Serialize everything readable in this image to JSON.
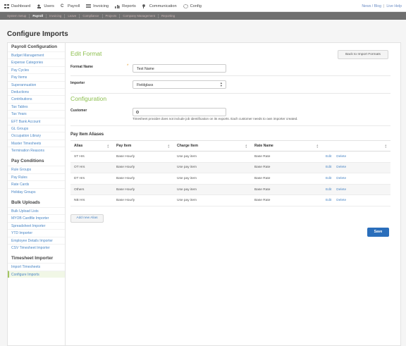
{
  "topnav": [
    {
      "label": "Dashboard",
      "icon": "dashboard-icon"
    },
    {
      "label": "Users",
      "icon": "users-icon"
    },
    {
      "label": "Payroll",
      "icon": "payroll-icon"
    },
    {
      "label": "Invoicing",
      "icon": "invoicing-icon"
    },
    {
      "label": "Reports",
      "icon": "reports-icon"
    },
    {
      "label": "Communication",
      "icon": "communication-icon"
    },
    {
      "label": "Config",
      "icon": "gear-icon"
    }
  ],
  "toplinks": {
    "news": "News / Blog",
    "help": "Live Help"
  },
  "subnav": [
    "System Setup",
    "Payroll",
    "Invoicing",
    "Leave",
    "Compliance",
    "Projects",
    "Company Management",
    "Reporting"
  ],
  "page_title": "Configure Imports",
  "sidebar": {
    "sections": [
      {
        "title": "Payroll Configuration",
        "items": [
          "Budget Management",
          "Expense Categories",
          "Pay Cycles",
          "Pay Items",
          "Superannuation",
          "Deductions",
          "Contributions",
          "Tax Tables",
          "Tax Years",
          "EFT Bank Account",
          "GL Groups",
          "Occupation Library",
          "Master Timesheets",
          "Termination Reasons"
        ]
      },
      {
        "title": "Pay Conditions",
        "items": [
          "Rule Groups",
          "Pay Rules",
          "Rate Cards",
          "Holiday Groups"
        ]
      },
      {
        "title": "Bulk Uploads",
        "items": [
          "Bulk Upload Lists",
          "MYOB Cardfile Importer",
          "Spreadsheet Importer",
          "YTD Importer",
          "Employee Details Importer",
          "CSV Timesheet Importer"
        ]
      },
      {
        "title": "Timesheet Importer",
        "items": [
          "Import Timesheets",
          "Configure Imports"
        ]
      }
    ],
    "active_item": "Configure Imports"
  },
  "edit_format": {
    "heading": "Edit Format",
    "back_button": "Back to Import Formats",
    "format_name_label": "Format Name",
    "required_mark": "*",
    "format_name_value": "Test Name",
    "importer_label": "Importer",
    "importer_value": "Fieldglass"
  },
  "configuration": {
    "heading": "Configuration",
    "customer_label": "Customer",
    "customer_value": "",
    "hint": "Timesheet provider does not include job identification on its exports. Each customer needs to own importer created."
  },
  "aliases": {
    "heading": "Pay Item Aliases",
    "columns": [
      "Alias",
      "Pay Item",
      "Charge Item",
      "Rate Name",
      ""
    ],
    "rows": [
      {
        "alias": "ST Hrs",
        "pay_item": "Base Hourly",
        "charge_item": "Use pay item",
        "rate_name": "Base Rate"
      },
      {
        "alias": "OT Hrs",
        "pay_item": "Base Hourly",
        "charge_item": "Use pay item",
        "rate_name": "Base Rate"
      },
      {
        "alias": "DT Hrs",
        "pay_item": "Base Hourly",
        "charge_item": "Use pay item",
        "rate_name": "Base Rate"
      },
      {
        "alias": "Others",
        "pay_item": "Base Hourly",
        "charge_item": "Use pay item",
        "rate_name": "Base Rate"
      },
      {
        "alias": "NB Hrs",
        "pay_item": "Base Hourly",
        "charge_item": "Use pay item",
        "rate_name": "Base Rate"
      }
    ],
    "edit_label": "Edit",
    "delete_label": "Delete",
    "add_button": "Add new Alias"
  },
  "save_button": "Save",
  "colors": {
    "accent_green": "#8cbf4e",
    "link_blue": "#4a86c5",
    "save_blue": "#2a6ebb",
    "subnav_bg": "#6f6f6f"
  }
}
